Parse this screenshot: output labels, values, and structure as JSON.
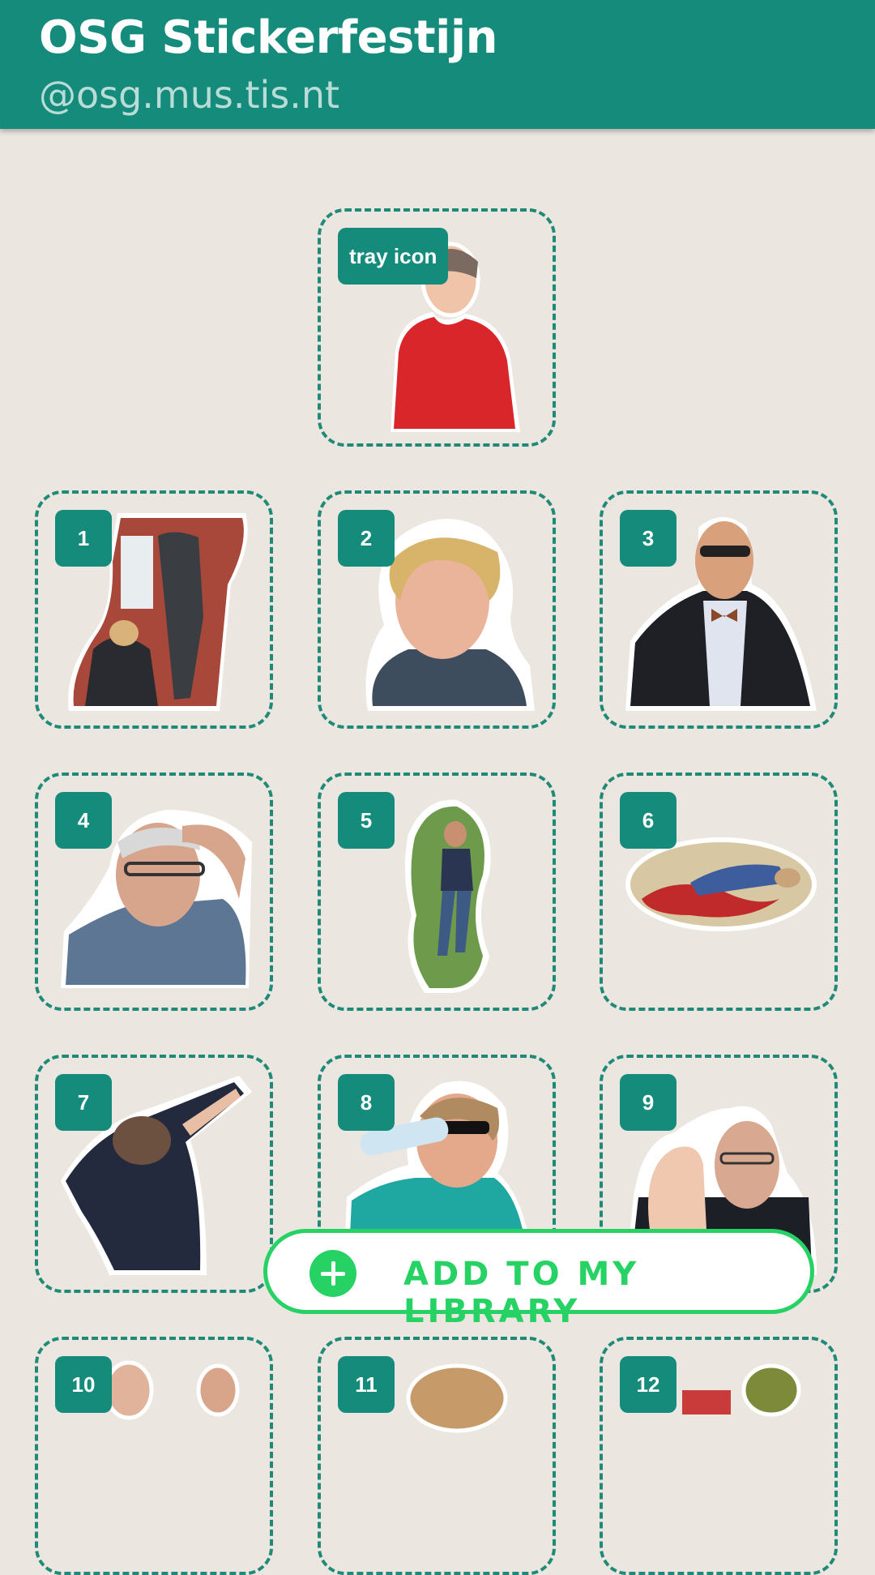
{
  "header": {
    "title": "OSG Stickerfestijn",
    "subtitle": "@osg.mus.tis.nt"
  },
  "tray": {
    "badge": "tray icon"
  },
  "stickers": [
    {
      "badge": "1"
    },
    {
      "badge": "2"
    },
    {
      "badge": "3"
    },
    {
      "badge": "4"
    },
    {
      "badge": "5"
    },
    {
      "badge": "6"
    },
    {
      "badge": "7"
    },
    {
      "badge": "8"
    },
    {
      "badge": "9"
    },
    {
      "badge": "10"
    },
    {
      "badge": "11"
    },
    {
      "badge": "12"
    }
  ],
  "add_button": {
    "label": "ADD TO MY LIBRARY",
    "icon": "plus-circle-icon"
  },
  "colors": {
    "primary": "#148b7b",
    "background": "#ece6e0",
    "dashed_border": "#1f8a78",
    "accent_green": "#27d264"
  }
}
